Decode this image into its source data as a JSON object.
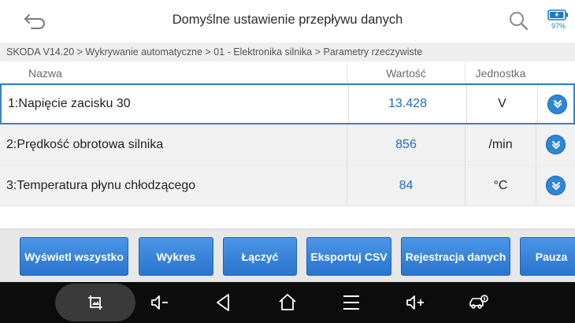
{
  "header": {
    "title": "Domyślne ustawienie przepływu danych",
    "back_icon": "back-arrow-icon",
    "search_icon": "search-icon",
    "battery_percent": "97%",
    "battery_level": 0.97
  },
  "breadcrumb": "SKODA V14.20 > Wykrywanie automatyczne  > 01 - Elektronika silnika > Parametry rzeczywiste",
  "table": {
    "columns": {
      "name": "Nazwa",
      "value": "Wartość",
      "unit": "Jednostka"
    },
    "rows": [
      {
        "name": "1:Napięcie zacisku 30",
        "value": "13.428",
        "unit": "V"
      },
      {
        "name": "2:Prędkość obrotowa silnika",
        "value": "856",
        "unit": "/min"
      },
      {
        "name": "3:Temperatura płynu chłodzącego",
        "value": "84",
        "unit": "°C"
      }
    ]
  },
  "buttons": {
    "show_all": "Wyświetl wszystko",
    "graph": "Wykres",
    "combine": "Łączyć",
    "export_csv": "Eksportuj CSV",
    "record": "Rejestracja danych",
    "pause": "Pauza"
  },
  "colors": {
    "accent": "#2a74cf",
    "value_text": "#1b6fbf",
    "selected_border": "#3b82c4"
  },
  "navbar": {
    "icons": [
      "screenshot-icon",
      "volume-down-icon",
      "back-triangle-icon",
      "home-icon",
      "recent-apps-icon",
      "volume-up-icon",
      "car-diagnostics-icon"
    ]
  }
}
